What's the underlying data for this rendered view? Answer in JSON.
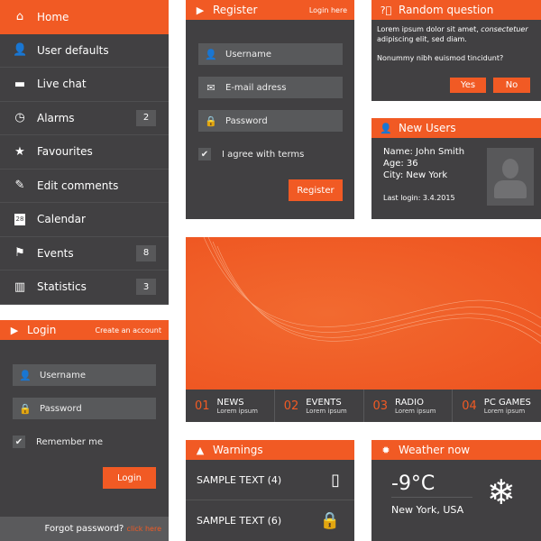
{
  "sidebar": {
    "items": [
      {
        "label": "Home",
        "icon": "home-icon",
        "glyph": "⌂",
        "active": true
      },
      {
        "label": "User defaults",
        "icon": "user-icon",
        "glyph": "👤"
      },
      {
        "label": "Live chat",
        "icon": "chat-icon",
        "glyph": "▬"
      },
      {
        "label": "Alarms",
        "icon": "clock-icon",
        "glyph": "◷",
        "badge": "2"
      },
      {
        "label": "Favourites",
        "icon": "star-icon",
        "glyph": "★"
      },
      {
        "label": "Edit comments",
        "icon": "pencil-icon",
        "glyph": "✎"
      },
      {
        "label": "Calendar",
        "icon": "calendar-icon",
        "glyph": "28"
      },
      {
        "label": "Events",
        "icon": "flag-icon",
        "glyph": "⚑",
        "badge": "8"
      },
      {
        "label": "Statistics",
        "icon": "chart-icon",
        "glyph": "▥",
        "badge": "3"
      }
    ]
  },
  "login": {
    "title": "Login",
    "create": "Create an account",
    "username": "Username",
    "password": "Password",
    "remember": "Remember me",
    "button": "Login",
    "forgot": "Forgot password?",
    "click": "click here"
  },
  "register": {
    "title": "Register",
    "login_link": "Login here",
    "username": "Username",
    "email": "E-mail adress",
    "password": "Password",
    "agree": "I agree with terms",
    "button": "Register"
  },
  "question": {
    "title": "Random question",
    "text1": "Lorem ipsum dolor sit amet, ",
    "text1_italic": "consectetuer",
    "text2": "adipiscing elit, sed diam.",
    "text3": "Nonummy nibh euismod tincidunt?",
    "yes": "Yes",
    "no": "No"
  },
  "new_users": {
    "title": "New Users",
    "name": "Name: John Smith",
    "age": "Age: 36",
    "city": "City: New York",
    "last_login": "Last login: 3.4.2015"
  },
  "tabs": [
    {
      "num": "01",
      "title": "NEWS",
      "sub": "Lorem ipsum"
    },
    {
      "num": "02",
      "title": "EVENTS",
      "sub": "Lorem ipsum"
    },
    {
      "num": "03",
      "title": "RADIO",
      "sub": "Lorem ipsum"
    },
    {
      "num": "04",
      "title": "PC GAMES",
      "sub": "Lorem ipsum"
    }
  ],
  "warnings": {
    "title": "Warnings",
    "rows": [
      {
        "text": "SAMPLE TEXT (4)",
        "icon": "phone-icon"
      },
      {
        "text": "SAMPLE TEXT (6)",
        "icon": "lock-icon"
      }
    ]
  },
  "weather": {
    "title": "Weather now",
    "temp": "-9°C",
    "city": "New York, USA",
    "icon": "snowflake-icon"
  },
  "colors": {
    "accent": "#f15a24",
    "panel": "#414042",
    "field": "#58595b"
  }
}
